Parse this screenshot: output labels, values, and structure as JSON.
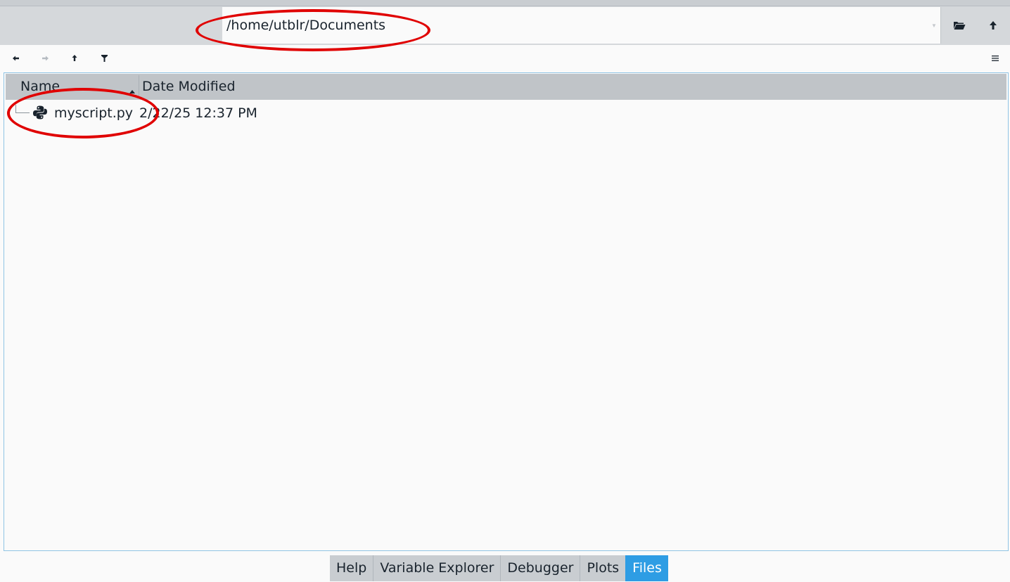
{
  "pathbar": {
    "path": "/home/utblr/Documents",
    "browse_icon": "folder-open-icon",
    "parent_icon": "arrow-up-icon"
  },
  "navbar": {
    "back_icon": "arrow-left-icon",
    "forward_icon": "arrow-right-icon",
    "up_icon": "arrow-up-icon",
    "filter_icon": "filter-icon",
    "options_icon": "menu-icon"
  },
  "tree": {
    "columns": {
      "name": "Name",
      "date": "Date Modified"
    },
    "rows": [
      {
        "name": "myscript.py",
        "date": "2/22/25 12:37 PM",
        "icon": "python-file-icon"
      }
    ]
  },
  "tabs": [
    {
      "label": "Help",
      "active": false
    },
    {
      "label": "Variable Explorer",
      "active": false
    },
    {
      "label": "Debugger",
      "active": false
    },
    {
      "label": "Plots",
      "active": false
    },
    {
      "label": "Files",
      "active": true
    }
  ],
  "colors": {
    "accent": "#2e9de4",
    "annotation": "#e00000",
    "header_bg": "#c0c4c8"
  }
}
